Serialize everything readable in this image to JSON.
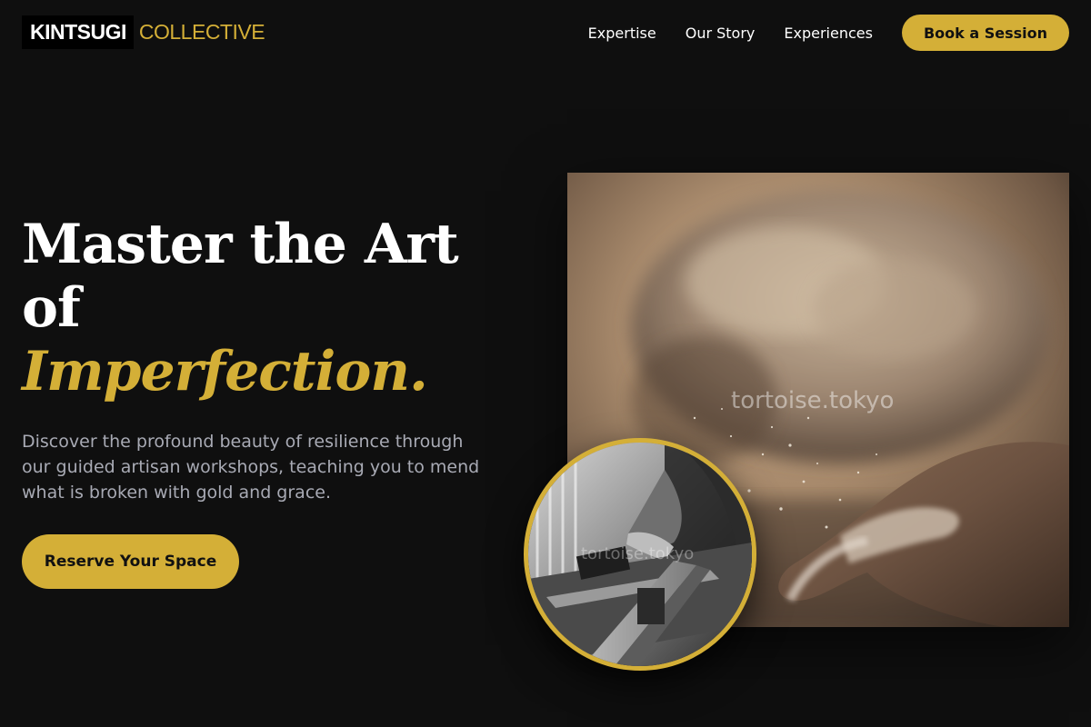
{
  "brand": {
    "primary": "KINTSUGI",
    "secondary": "COLLECTIVE",
    "accent_color": "#d4af37",
    "background_color": "#0f0f0f"
  },
  "nav": {
    "links": [
      "Expertise",
      "Our Story",
      "Experiences"
    ],
    "cta_label": "Book a Session"
  },
  "hero": {
    "title_line1": "Master the Art",
    "title_line2": "of",
    "title_accent": "Imperfection.",
    "description": "Discover the profound beauty of resilience through our guided artisan workshops, teaching you to mend what is broken with gold and grace.",
    "cta_label": "Reserve Your Space"
  },
  "images": {
    "main_watermark": "tortoise.tokyo",
    "inset_watermark": "tortoise.tokyo",
    "main_subject": "hands-in-flour-photo",
    "inset_subject": "woodworker-table-saw-photo"
  }
}
